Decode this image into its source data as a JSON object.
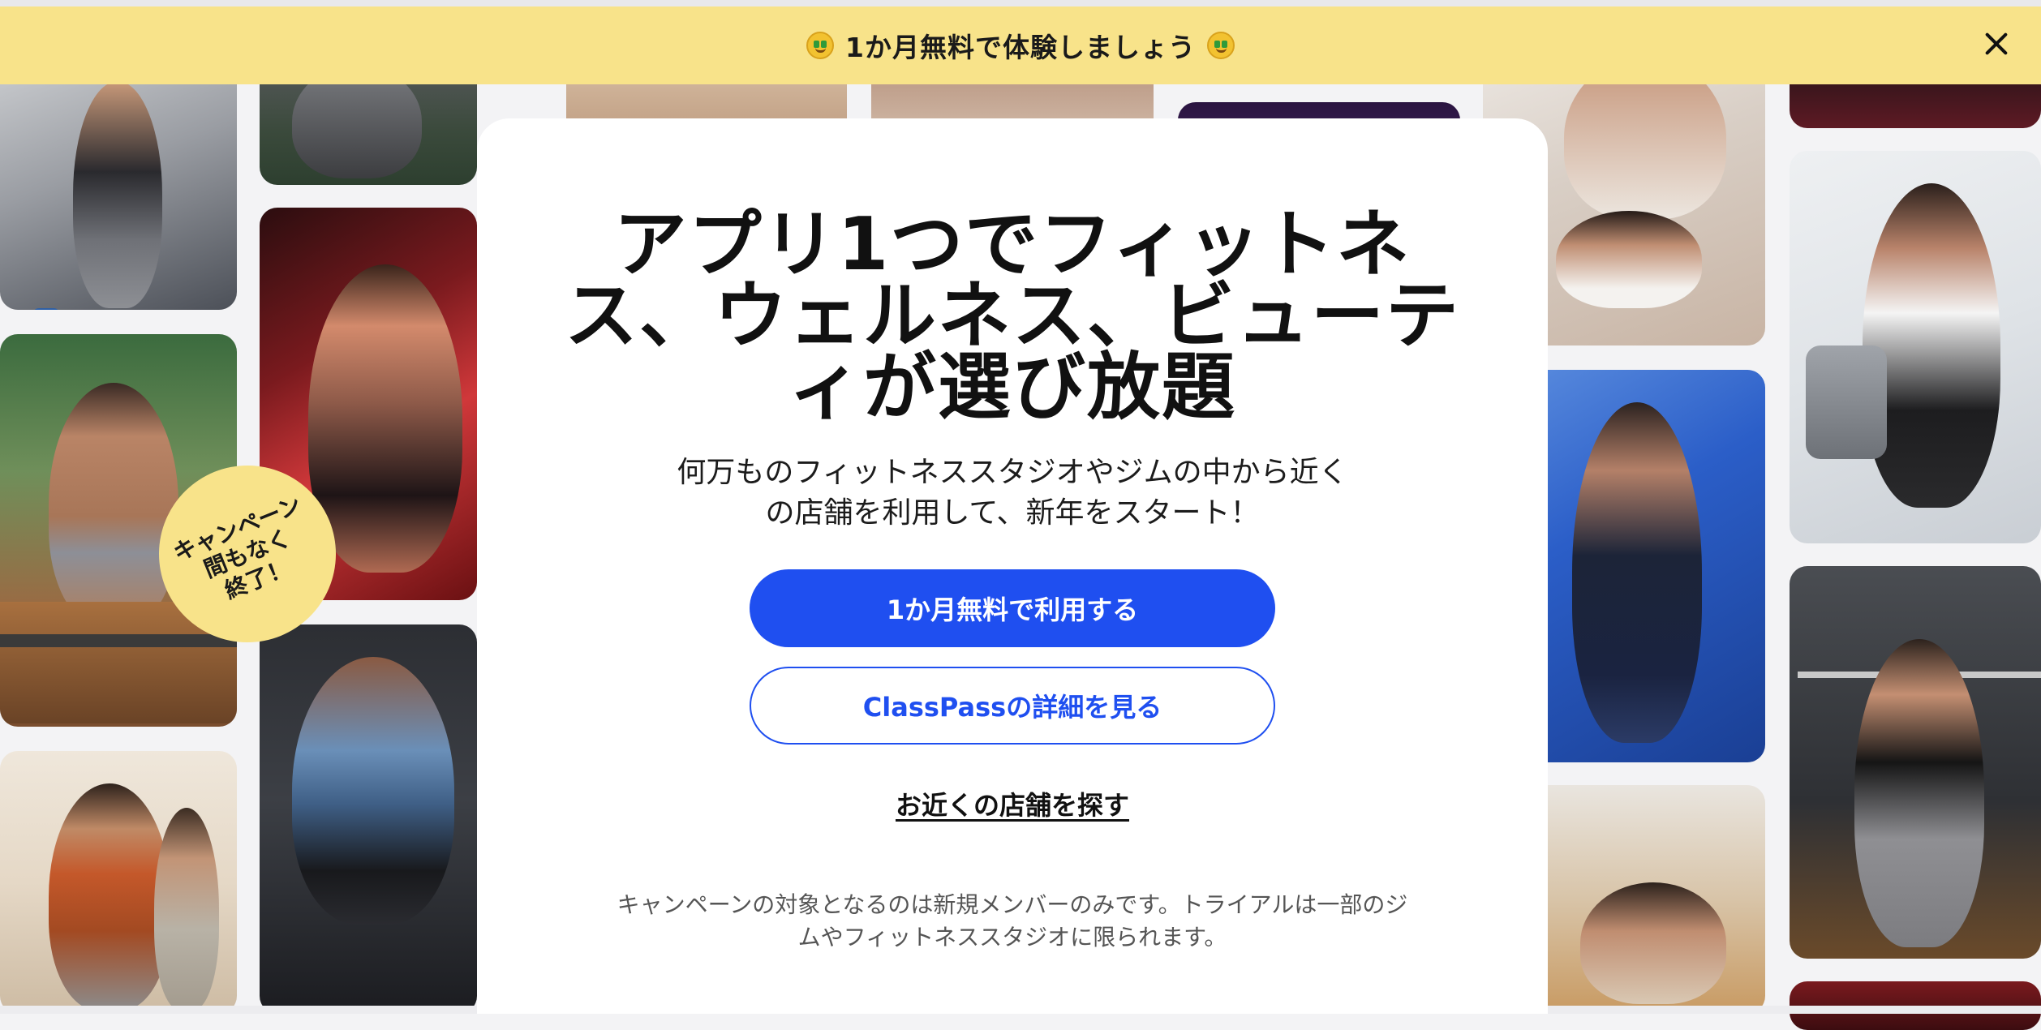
{
  "banner": {
    "text": "1か月無料で体験しましょう",
    "left_icon": "money-mouth-emoji",
    "right_icon": "money-mouth-emoji",
    "close_icon": "close-icon",
    "background_color": "#f8e38a"
  },
  "badge": {
    "text": "キャンペーン\n間もなく\n終了！",
    "color": "#f8e38a"
  },
  "modal": {
    "headline": "アプリ1つでフィットネス、ウェルネス、ビューティが選び放題",
    "subtext": "何万ものフィットネススタジオやジムの中から近くの店舗を利用して、新年をスタート！",
    "primary_button": "1か月無料で利用する",
    "secondary_button": "ClassPassの詳細を見る",
    "find_link": "お近くの店舗を探す",
    "footnote": "キャンペーンの対象となるのは新規メンバーのみです。トライアルは一部のジムやフィットネススタジオに限られます。",
    "accent_color": "#1f4ff0"
  },
  "photos": [
    {
      "name": "treadmill-runner-photo"
    },
    {
      "name": "ice-bath-woman-photo"
    },
    {
      "name": "dumbbell-class-photo"
    },
    {
      "name": "battle-ropes-photo"
    },
    {
      "name": "red-light-cycling-photo"
    },
    {
      "name": "rowing-machine-photo"
    },
    {
      "name": "stretching-photo"
    },
    {
      "name": "facial-treatment-photo"
    },
    {
      "name": "dark-studio-photo"
    },
    {
      "name": "facial-massage-photo"
    },
    {
      "name": "cable-training-photo"
    },
    {
      "name": "pilates-ab-photo"
    },
    {
      "name": "dark-red-studio-photo"
    },
    {
      "name": "stationary-bike-photo"
    },
    {
      "name": "barbell-squat-photo"
    },
    {
      "name": "red-studio-bottom-photo"
    }
  ]
}
